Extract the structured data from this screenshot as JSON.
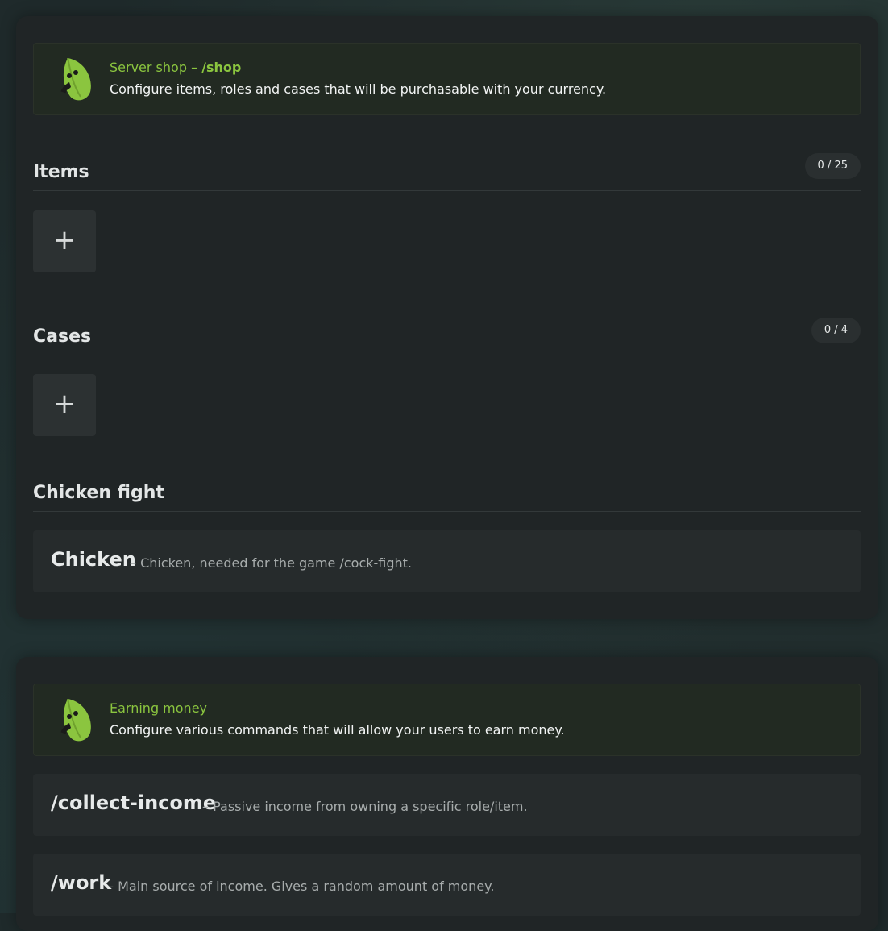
{
  "shop_panel": {
    "banner": {
      "title": "Server shop – ",
      "command": "/shop",
      "description": "Configure items, roles and cases that will be purchasable with your currency."
    },
    "items": {
      "title": "Items",
      "count": "0 / 25",
      "add_label": "+"
    },
    "cases": {
      "title": "Cases",
      "count": "0 / 4",
      "add_label": "+"
    },
    "chicken_fight": {
      "title": "Chicken fight",
      "row": {
        "name": "Chicken",
        "description": "– Chicken, needed for the game /cock-fight."
      }
    }
  },
  "earn_panel": {
    "banner": {
      "title": "Earning money",
      "description": "Configure various commands that will allow your users to earn money."
    },
    "commands": [
      {
        "name": "/collect-income",
        "description": "– Passive income from owning a specific role/item."
      },
      {
        "name": "/work",
        "description": "– Main source of income. Gives a random amount of money."
      }
    ]
  },
  "icons": {
    "banner_icon": "leaf-mascot-icon",
    "add_icon": "plus-icon"
  },
  "colors": {
    "accent": "#8bc53f",
    "background": "#1f2a2b",
    "panel": "#202526"
  }
}
